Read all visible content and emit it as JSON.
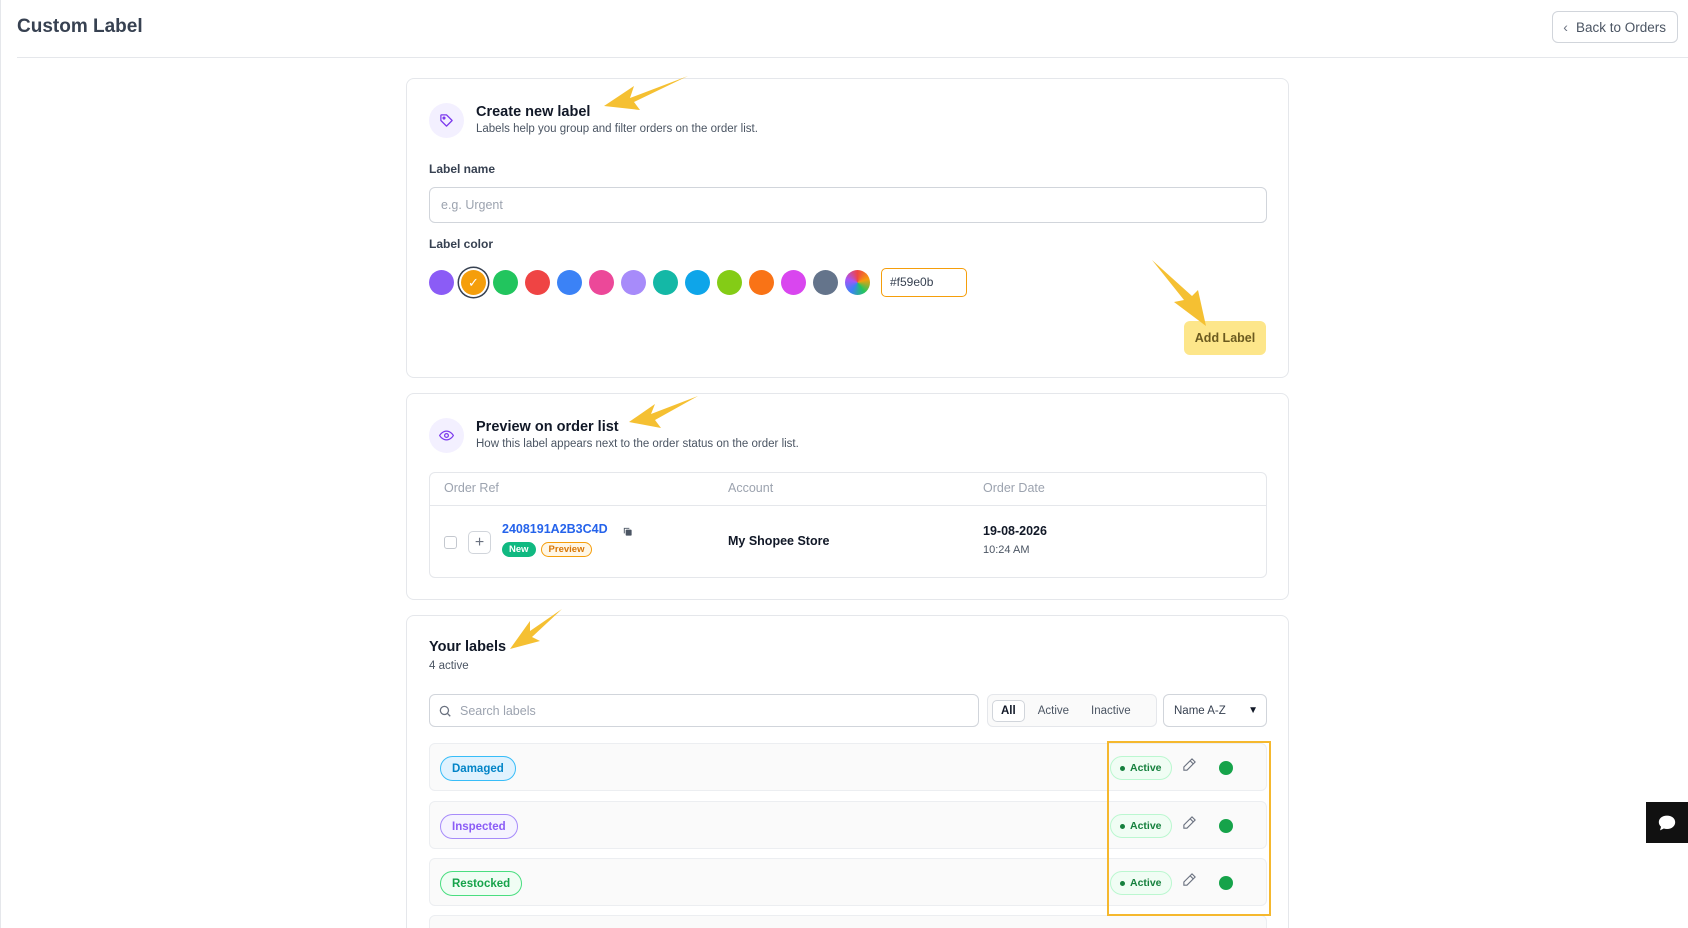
{
  "header": {
    "title": "Custom Label",
    "back_label": "Back to Orders"
  },
  "create": {
    "title": "Create new label",
    "subtitle": "Labels help you group and filter orders on the order list.",
    "name_label": "Label name",
    "name_placeholder": "e.g. Urgent",
    "color_label": "Label color",
    "swatches": [
      "#8b5cf6",
      "#f59e0b",
      "#22c55e",
      "#ef4444",
      "#3b82f6",
      "#ec4899",
      "#a78bfa",
      "#14b8a6",
      "#0ea5e9",
      "#84cc16",
      "#f97316",
      "#d946ef",
      "#64748b"
    ],
    "selected_color": "#f59e0b",
    "hex_value": "#f59e0b",
    "add_button": "Add Label"
  },
  "preview": {
    "title": "Preview on order list",
    "subtitle": "How this label appears next to the order status on the order list.",
    "columns": [
      "Order Ref",
      "Account",
      "Order Date"
    ],
    "row": {
      "order_ref": "2408191A2B3C4D",
      "badge_new": "New",
      "badge_preview": "Preview",
      "account": "My Shopee Store",
      "date": "19-08-2026",
      "time": "10:24 AM"
    }
  },
  "labels": {
    "title": "Your labels",
    "count": "4 active",
    "search_placeholder": "Search labels",
    "filters": [
      "All",
      "Active",
      "Inactive"
    ],
    "sort": "Name A-Z",
    "items": [
      {
        "name": "Damaged",
        "status": "Active",
        "text_color": "#0284c7",
        "bg_color": "#e0f2fe",
        "border_color": "#38bdf8"
      },
      {
        "name": "Inspected",
        "status": "Active",
        "text_color": "#8b5cf6",
        "bg_color": "#f5f3ff",
        "border_color": "#a78bfa"
      },
      {
        "name": "Restocked",
        "status": "Active",
        "text_color": "#16a34a",
        "bg_color": "#f0fdf4",
        "border_color": "#4ade80"
      }
    ]
  },
  "colors": {
    "accent": "#f59e0b",
    "link": "#2563eb",
    "annotation": "#f5b82e"
  },
  "icons": [
    "chevron-left-icon",
    "tag-icon",
    "check-icon",
    "eye-icon",
    "copy-icon",
    "plus-icon",
    "search-icon",
    "chevron-down-icon",
    "pencil-icon",
    "chat-icon"
  ]
}
